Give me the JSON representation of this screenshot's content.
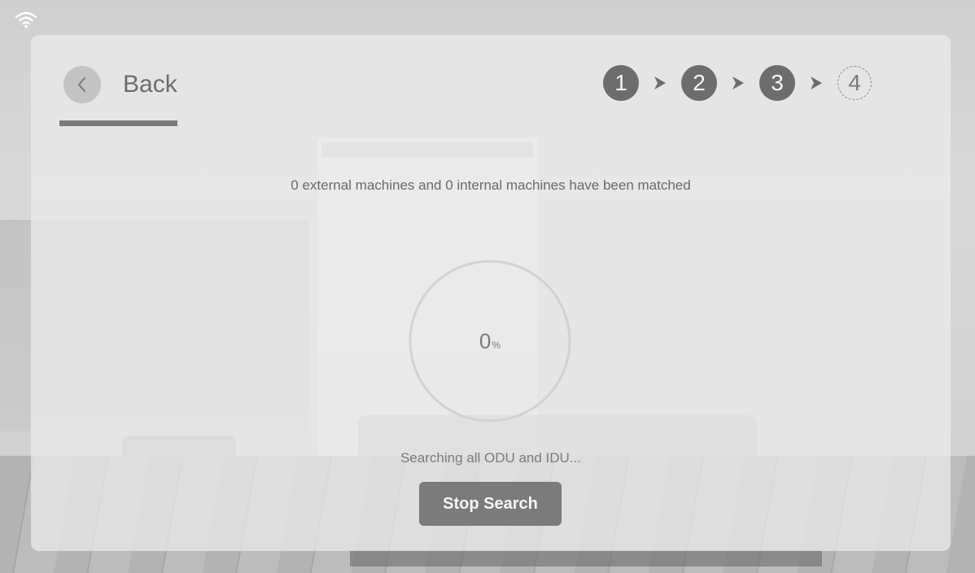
{
  "header": {
    "back_label": "Back"
  },
  "steps": [
    {
      "label": "1",
      "state": "done"
    },
    {
      "label": "2",
      "state": "done"
    },
    {
      "label": "3",
      "state": "done"
    },
    {
      "label": "4",
      "state": "pending"
    }
  ],
  "status": {
    "matched_text": "0 external machines and 0 internal machines have been matched",
    "progress_value": "0",
    "progress_unit": "%",
    "searching_text": "Searching all ODU and IDU..."
  },
  "actions": {
    "stop_label": "Stop Search"
  },
  "icons": {
    "wifi": "wifi-icon",
    "back": "chevron-left-icon",
    "step_separator": "chevron-right-icon"
  },
  "colors": {
    "accent": "#6d6d6d",
    "panel": "#ececec"
  }
}
